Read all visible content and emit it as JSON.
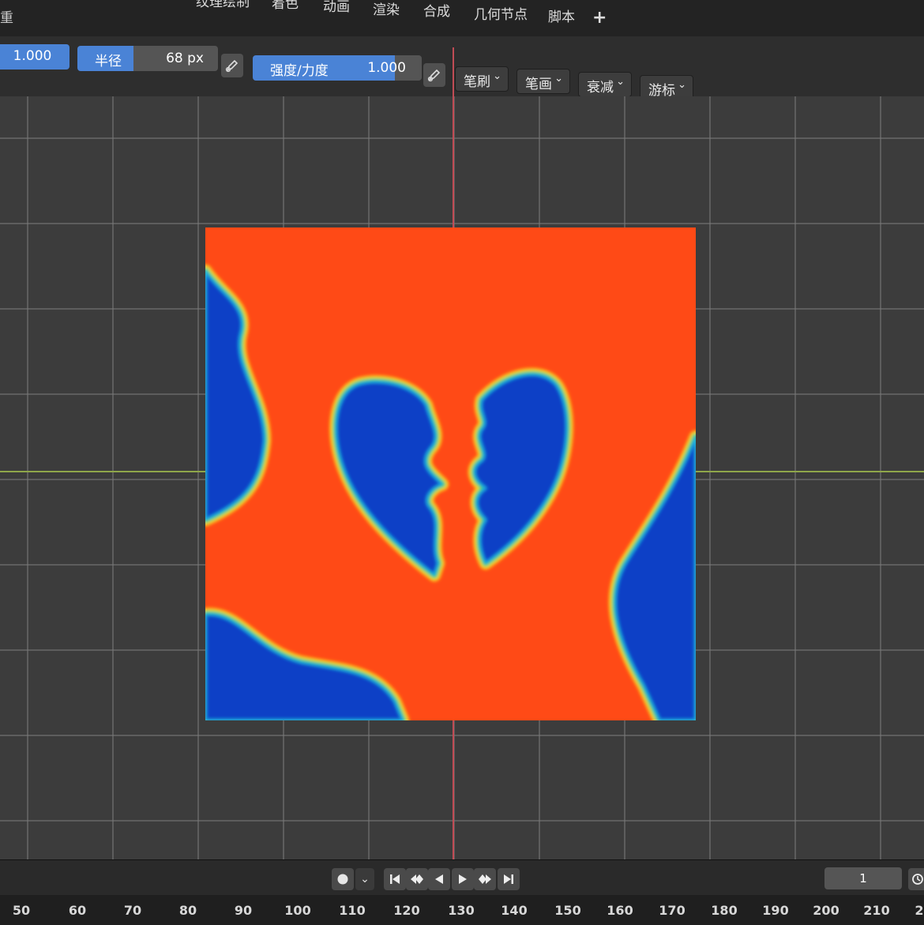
{
  "workspace_tabs": [
    "纹理绘制",
    "着色",
    "动画",
    "渲染",
    "合成",
    "几何节点",
    "脚本"
  ],
  "workspace_add": "+",
  "left_fragment": "重",
  "header": {
    "first_value": "1.000",
    "radius": {
      "label": "半径",
      "value": "68 px"
    },
    "strength": {
      "label": "强度/力度",
      "value": "1.000"
    },
    "dropdowns": [
      "笔刷",
      "笔画",
      "衰减",
      "游标"
    ]
  },
  "icons": {
    "pen": "pen-pressure-icon",
    "chevron": "chevron-down-icon",
    "record": "record-icon",
    "jump_start": "jump-start-icon",
    "prev_key": "prev-keyframe-icon",
    "play_reverse": "play-reverse-icon",
    "play": "play-icon",
    "next_key": "next-keyframe-icon",
    "jump_end": "jump-end-icon"
  },
  "colors": {
    "accent_field": "#4a83d6",
    "texture_hot": "#ff4a16",
    "texture_cold": "#0a3fc6",
    "axis_x": "#c14c55",
    "axis_y": "#8fa64a"
  },
  "timeline": {
    "current_frame": "1",
    "ruler_ticks": [
      "50",
      "60",
      "70",
      "80",
      "90",
      "100",
      "110",
      "120",
      "130",
      "140",
      "150",
      "160",
      "170",
      "180",
      "190",
      "200",
      "210",
      "2"
    ]
  }
}
